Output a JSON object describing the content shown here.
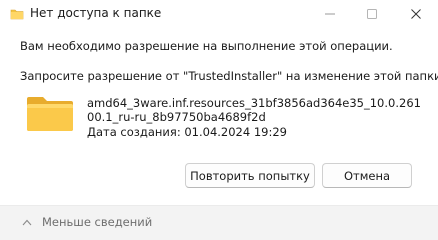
{
  "window": {
    "title": "Нет доступа к папке",
    "controls": [
      "minimize-icon",
      "maximize-icon",
      "close-icon"
    ]
  },
  "message": {
    "line1": "Вам необходимо разрешение на выполнение этой операции.",
    "line2": "Запросите разрешение от \"TrustedInstaller\" на изменение этой папки"
  },
  "item": {
    "icon": "folder-icon",
    "name": "amd64_3ware.inf.resources_31bf3856ad364e35_10.0.26100.1_ru-ru_8b97750ba4689f2d",
    "date": "Дата создания: 01.04.2024 19:29"
  },
  "buttons": {
    "retry": "Повторить попытку",
    "cancel": "Отмена"
  },
  "footer": {
    "less_details": "Меньше сведений",
    "icon": "chevron-up-icon"
  },
  "colors": {
    "folder": "#f4c542",
    "folder_dark": "#e0a82e",
    "footer_bg": "#f3f3f3",
    "button_border": "#d0d0d0"
  }
}
